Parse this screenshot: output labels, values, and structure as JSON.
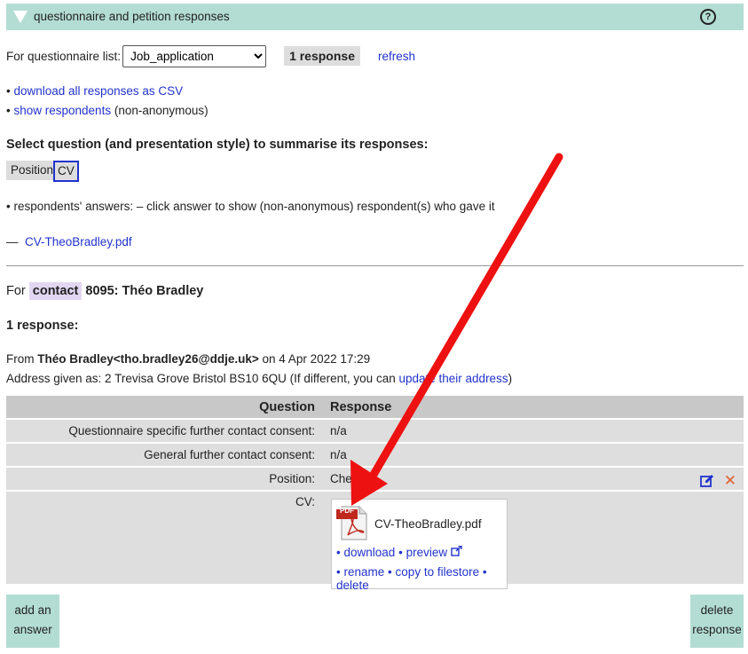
{
  "header": {
    "title": "questionnaire and petition responses",
    "help_glyph": "?"
  },
  "questionnaire": {
    "label": "For questionnaire list:",
    "selected": "Job_application",
    "response_count": "1 response",
    "refresh_label": "refresh"
  },
  "links": {
    "bullet": "•",
    "download_csv": "download all responses as CSV",
    "show_respondents": "show respondents",
    "non_anonymous": "(non-anonymous)"
  },
  "summary": {
    "heading": "Select question (and presentation style) to summarise its responses:",
    "buttons": [
      "Position",
      "CV"
    ],
    "answers_note": "• respondents' answers: – click answer to show (non-anonymous) respondent(s) who gave it",
    "answer_dash": "—",
    "answer_link": "CV-TheoBradley.pdf"
  },
  "contact": {
    "prefix": "For",
    "tag": "contact",
    "id_name": "8095: Théo Bradley"
  },
  "responses_heading": "1 response:",
  "response": {
    "from_label": "From",
    "from_name": "Théo Bradley<tho.bradley26@ddje.uk>",
    "date_text": "on 4 Apr 2022 17:29",
    "address_text": "Address given as: 2 Trevisa Grove Bristol BS10 6QU (If different, you can",
    "address_link": "update their address",
    "address_close": ")"
  },
  "table": {
    "head_q": "Question",
    "head_r": "Response",
    "rows": [
      {
        "q": "Questionnaire specific further contact consent:",
        "r": "n/a"
      },
      {
        "q": "General further contact consent:",
        "r": "n/a"
      },
      {
        "q": "Position:",
        "r": "Chef"
      },
      {
        "q": "CV:",
        "r": ""
      }
    ],
    "edit_icon": "edit-icon",
    "delete_glyph": "✕"
  },
  "file": {
    "name": "CV-TheoBradley.pdf",
    "pdf_label": "PDF",
    "download": "download",
    "preview": "preview",
    "rename": "rename",
    "copy": "copy to filestore",
    "delete": "delete",
    "sep": "•"
  },
  "buttons": {
    "add_answer_line1": "add an",
    "add_answer_line2": "answer",
    "delete_response_line1": "delete",
    "delete_response_line2": "response"
  },
  "colors": {
    "accent_bg": "#b3ddd2",
    "link": "#2233cc",
    "contact_tag": "#e2d7f2",
    "delete": "#e06030"
  }
}
